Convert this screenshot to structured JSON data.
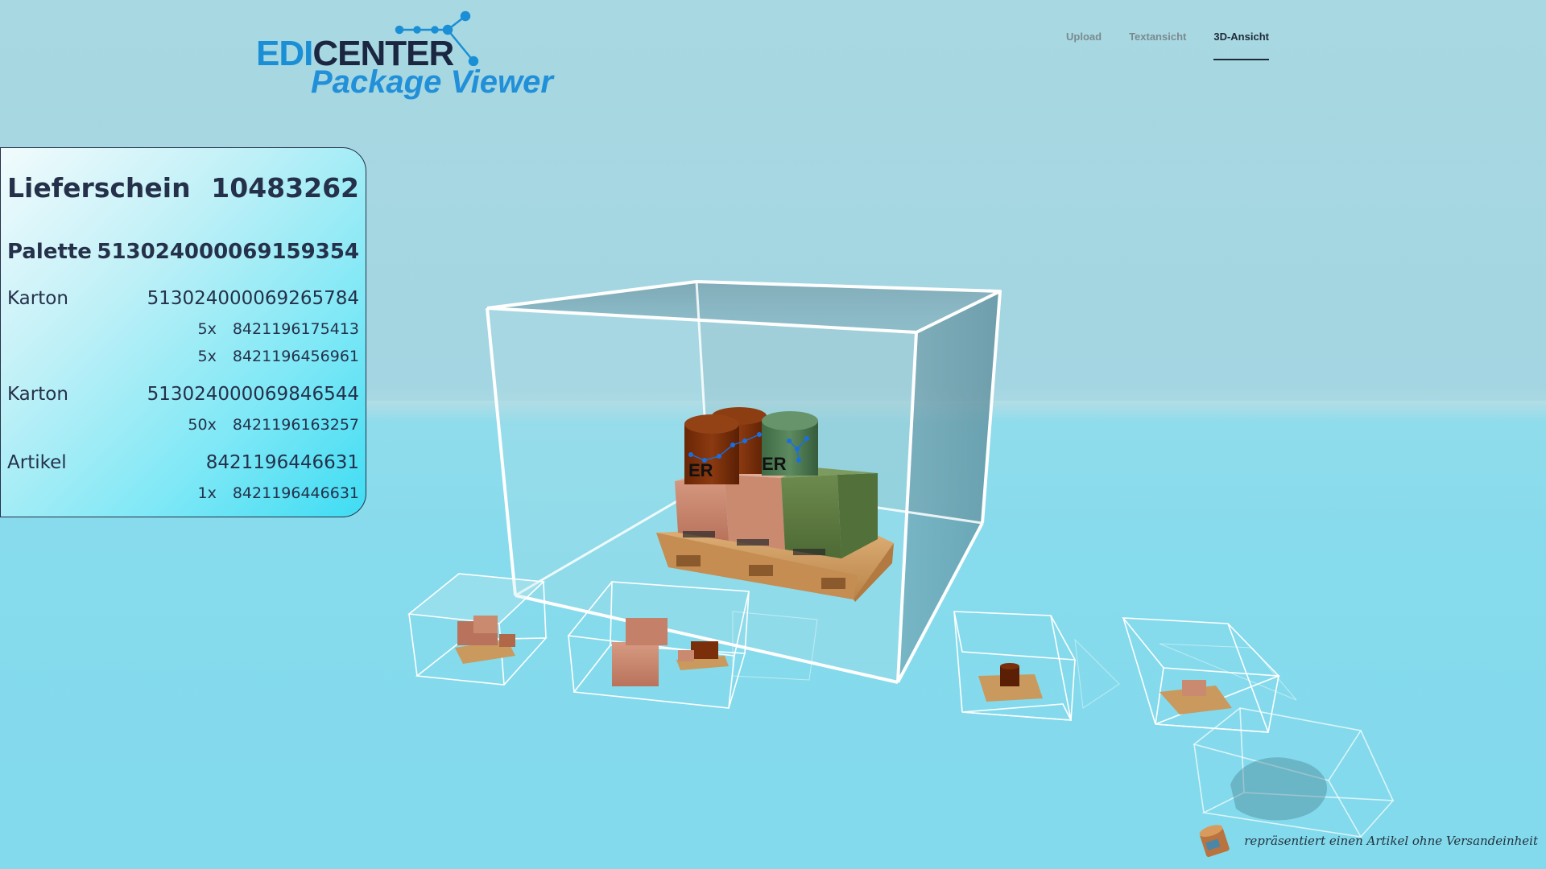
{
  "logo": {
    "brand_prefix": "EDI",
    "brand_suffix": "CENTER",
    "product": "Package Viewer"
  },
  "nav": {
    "items": [
      {
        "label": "Upload",
        "active": false
      },
      {
        "label": "Textansicht",
        "active": false
      },
      {
        "label": "3D-Ansicht",
        "active": true
      }
    ]
  },
  "panel": {
    "delivery_label": "Lieferschein",
    "delivery_number": "10483262",
    "pallet_label": "Palette",
    "pallet_number": "513024000069159354",
    "carton1": {
      "label": "Karton",
      "number": "513024000069265784",
      "items": [
        {
          "qty": "5x",
          "code": "8421196175413"
        },
        {
          "qty": "5x",
          "code": "8421196456961"
        }
      ]
    },
    "carton2": {
      "label": "Karton",
      "number": "513024000069846544",
      "items": [
        {
          "qty": "50x",
          "code": "8421196163257"
        }
      ]
    },
    "article": {
      "label": "Artikel",
      "number": "8421196446631",
      "items": [
        {
          "qty": "1x",
          "code": "8421196446631"
        }
      ]
    }
  },
  "legend": {
    "text": "repräsentiert einen Artikel ohne Versandeinheit"
  },
  "colors": {
    "accent_blue": "#1a8fd6",
    "dark_navy": "#1b2741",
    "panel_border": "#25314a"
  }
}
